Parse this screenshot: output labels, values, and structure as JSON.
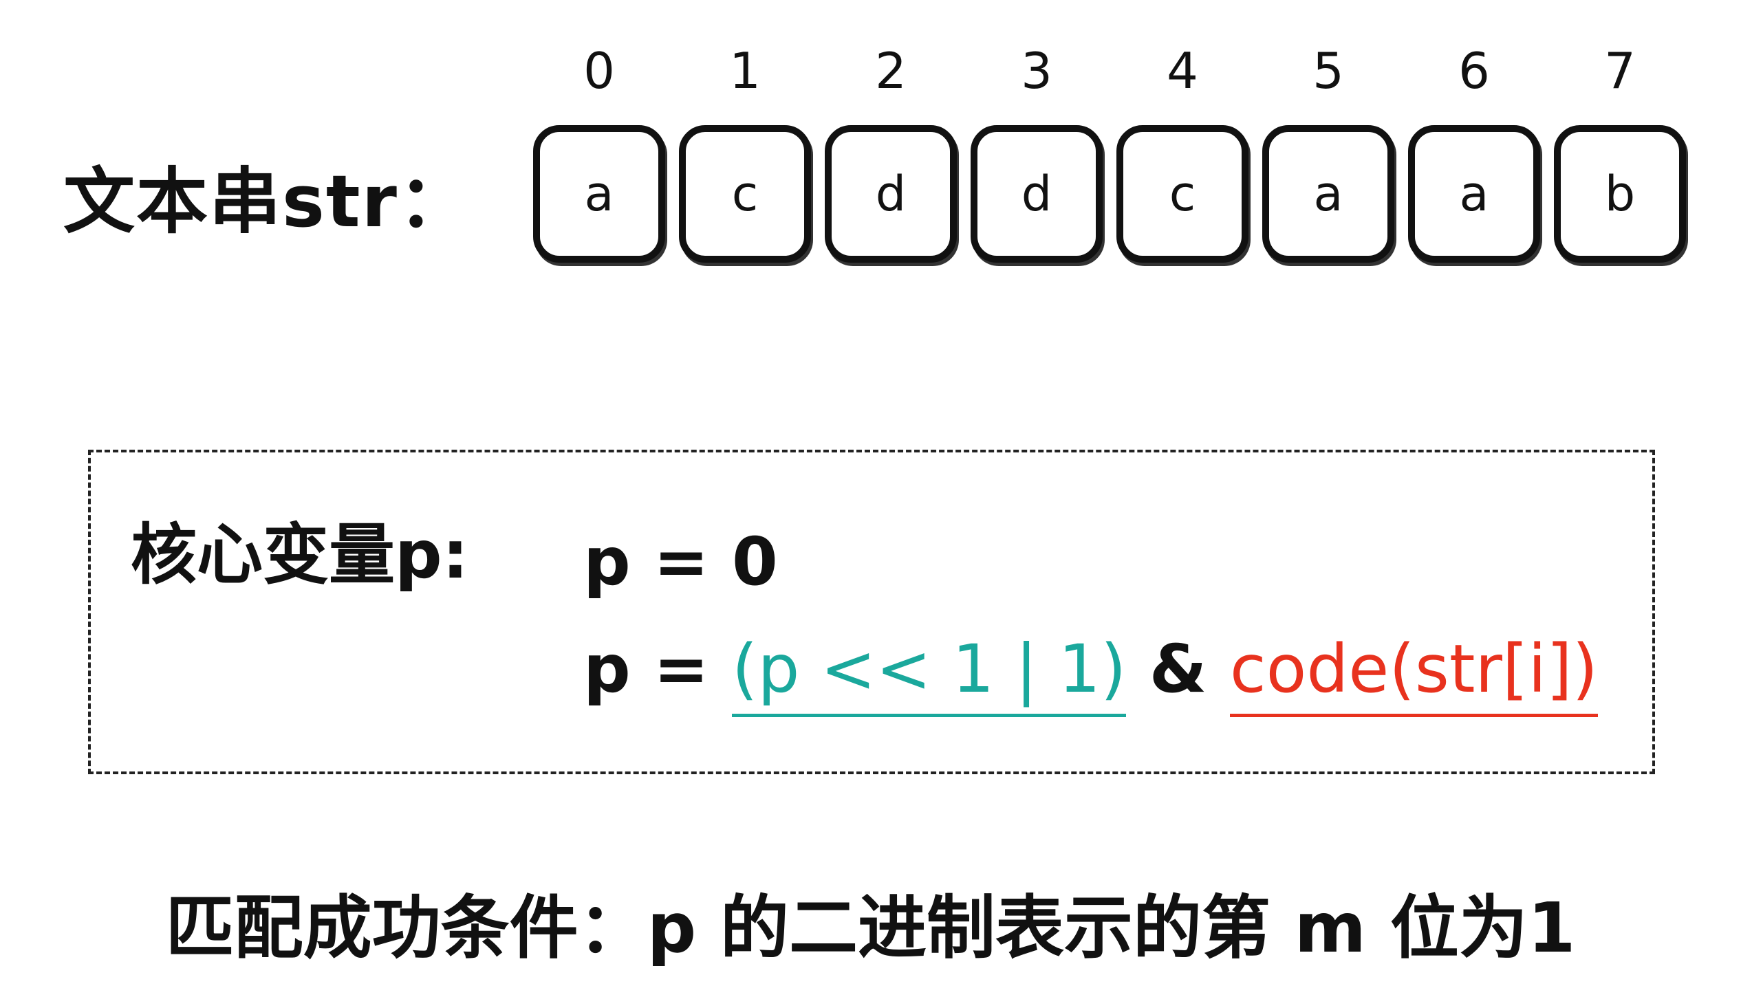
{
  "indices": [
    "0",
    "1",
    "2",
    "3",
    "4",
    "5",
    "6",
    "7"
  ],
  "text_string": {
    "label": "文本串str：",
    "chars": [
      "a",
      "c",
      "d",
      "d",
      "c",
      "a",
      "a",
      "b"
    ]
  },
  "core_variable": {
    "label": "核心变量p:",
    "init": "p = 0",
    "update_lhs": "p = ",
    "update_shift": "(p << 1 | 1)",
    "update_op": " & ",
    "update_mask": "code(str[i])",
    "colors": {
      "shift": "#1aa89c",
      "mask": "#e8321e"
    }
  },
  "condition": "匹配成功条件：p 的二进制表示的第 m 位为1"
}
